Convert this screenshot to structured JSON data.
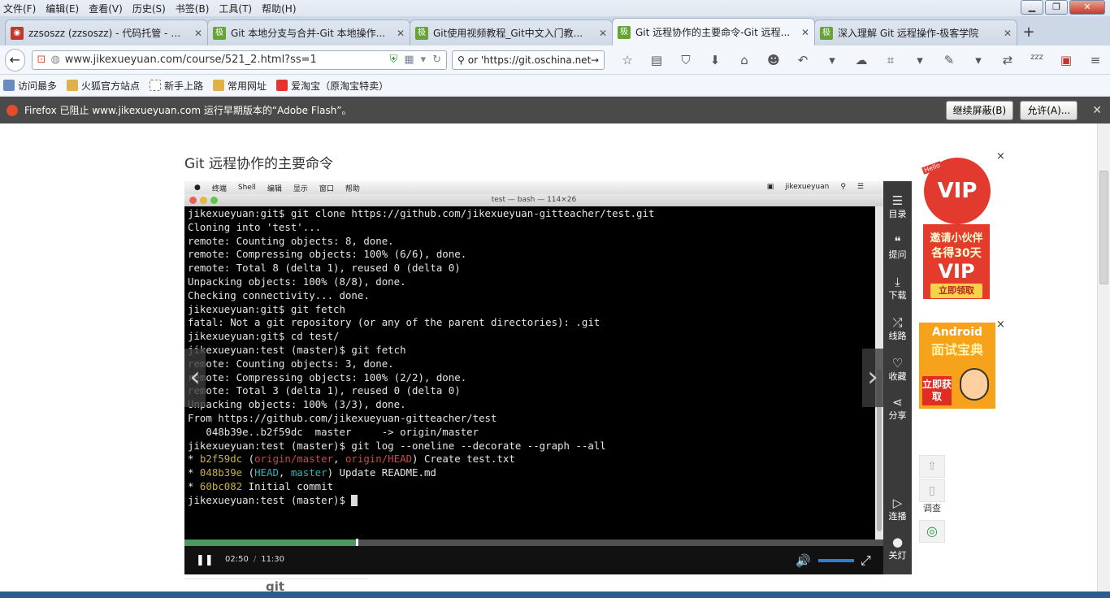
{
  "menu": [
    "文件(F)",
    "编辑(E)",
    "查看(V)",
    "历史(S)",
    "书签(B)",
    "工具(T)",
    "帮助(H)"
  ],
  "window_controls": {
    "min": "▁",
    "max": "❐",
    "close": "✕"
  },
  "tabs": [
    {
      "title": "zzsoszz (zzsoszz) - 代码托管 - 开...",
      "fav_color": "#c0392b",
      "fav": "◉",
      "active": false
    },
    {
      "title": "Git 本地分支与合并-Git 本地操作...",
      "fav_color": "#67a337",
      "fav": "极",
      "active": false
    },
    {
      "title": "Git使用视频教程_Git中文入门教...",
      "fav_color": "#67a337",
      "fav": "极",
      "active": false
    },
    {
      "title": "Git 远程协作的主要命令-Git 远程...",
      "fav_color": "#67a337",
      "fav": "极",
      "active": true
    },
    {
      "title": "深入理解 Git 远程操作-极客学院",
      "fav_color": "#67a337",
      "fav": "极",
      "active": false
    }
  ],
  "new_tab": "+",
  "nav": {
    "url": "www.jikexueyuan.com/course/521_2.html?ss=1",
    "search_text": "or 'https://git.oschina.net",
    "back_icon": "←",
    "toolbar_icons": [
      "☆",
      "▤",
      "⛉",
      "⬇",
      "⌂",
      "☻",
      "↶",
      "▾",
      "☁",
      "⌗",
      "▾",
      "✎",
      "▾",
      "⇄",
      "zzz",
      "▣",
      "≡"
    ]
  },
  "bookmarks": [
    {
      "label": "访问最多",
      "color": "#6a8bbf"
    },
    {
      "label": "火狐官方站点",
      "color": "#e0b04a"
    },
    {
      "label": "新手上路",
      "color": "#ffffff"
    },
    {
      "label": "常用网址",
      "color": "#e0b04a"
    },
    {
      "label": "爱淘宝（原淘宝特卖）",
      "color": "#e3342f"
    }
  ],
  "notification": {
    "text": "Firefox 已阻止 www.jikexueyuan.com 运行早期版本的“Adobe Flash”。",
    "continue_block": "继续屏蔽(B)",
    "allow": "允许(A)...",
    "close": "✕"
  },
  "page": {
    "title": "Git 远程协作的主要命令",
    "below_text": "git"
  },
  "mac_menubar": {
    "items": [
      "终端",
      "Shell",
      "编辑",
      "显示",
      "窗口",
      "帮助"
    ],
    "user": "jikexueyuan"
  },
  "terminal": {
    "title": "test — bash — 114×26",
    "lines": [
      "jikexueyuan:git$ git clone https://github.com/jikexueyuan-gitteacher/test.git",
      "Cloning into 'test'...",
      "remote: Counting objects: 8, done.",
      "remote: Compressing objects: 100% (6/6), done.",
      "remote: Total 8 (delta 1), reused 0 (delta 0)",
      "Unpacking objects: 100% (8/8), done.",
      "Checking connectivity... done.",
      "jikexueyuan:git$ git fetch",
      "fatal: Not a git repository (or any of the parent directories): .git",
      "jikexueyuan:git$ cd test/",
      "jikexueyuan:test (master)$ git fetch",
      "remote: Counting objects: 3, done.",
      "remote: Compressing objects: 100% (2/2), done.",
      "remote: Total 3 (delta 1), reused 0 (delta 0)",
      "Unpacking objects: 100% (3/3), done.",
      "From https://github.com/jikexueyuan-gitteacher/test",
      "   048b39e..b2f59dc  master     -> origin/master",
      "jikexueyuan:test (master)$ git log --oneline --decorate --graph --all"
    ],
    "log": [
      {
        "star": "* ",
        "hash": "b2f59dc",
        "open": " (",
        "refs": [
          "origin/master",
          "origin/HEAD"
        ],
        "ref_class": "red",
        "close": ") ",
        "msg": "Create test.txt"
      },
      {
        "star": "* ",
        "hash": "048b39e",
        "open": " (",
        "refs": [
          "HEAD",
          "master"
        ],
        "ref_class": "cyan",
        "close": ") ",
        "msg": "Update README.md"
      },
      {
        "star": "* ",
        "hash": "60bc082",
        "open": "",
        "refs": [],
        "ref_class": "",
        "close": " ",
        "msg": "Initial commit"
      }
    ],
    "prompt": "jikexueyuan:test (master)$ "
  },
  "player": {
    "current_time": "02:50",
    "total_time": "11:30",
    "progress_fraction": 0.2464,
    "prev": "‹",
    "next": "›",
    "play_icon": "❚❚",
    "volume_icon": "🔊",
    "fullscreen_icon": "⤢"
  },
  "side_panel": [
    {
      "icon": "☰",
      "label": "目录"
    },
    {
      "icon": "❝",
      "label": "提问"
    },
    {
      "icon": "⤓",
      "label": "下载"
    },
    {
      "icon": "⤮",
      "label": "线路"
    },
    {
      "icon": "♡",
      "label": "收藏"
    },
    {
      "icon": "⋖",
      "label": "分享"
    },
    {
      "icon": "▷",
      "label": "连播"
    },
    {
      "icon": "●",
      "label": "关灯"
    }
  ],
  "ads": {
    "vip": {
      "badge": "VIP",
      "hello": "Hello",
      "line1": "邀请小伙伴",
      "line2": "各得30天",
      "line3": "VIP",
      "button": "立即领取"
    },
    "android": {
      "line1": "Android",
      "line2": "面试宝典",
      "button": "立即获取"
    },
    "close": "×"
  },
  "float_widgets": {
    "top": "⇧",
    "phone": "▯",
    "survey": "调查",
    "wechat": "◎"
  }
}
